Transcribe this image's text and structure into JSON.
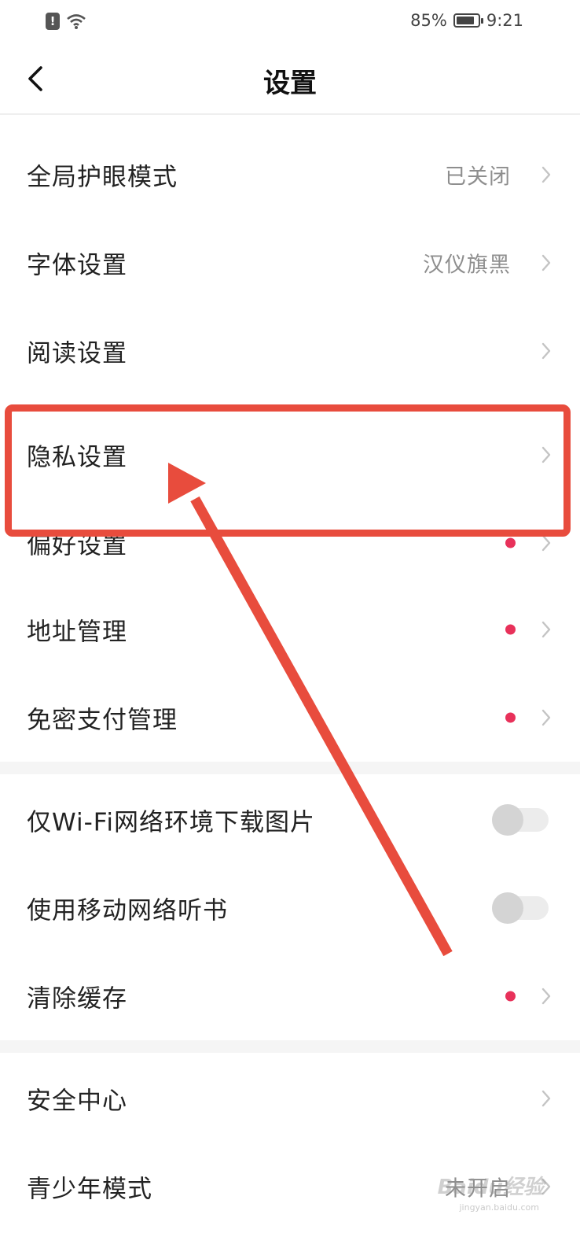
{
  "status_bar": {
    "battery_percent": "85%",
    "battery_level": 0.85,
    "time": "9:21"
  },
  "header": {
    "title": "设置"
  },
  "section1": [
    {
      "label": "全局护眼模式",
      "value": "已关闭"
    },
    {
      "label": "字体设置",
      "value": "汉仪旗黑"
    },
    {
      "label": "阅读设置"
    },
    {
      "label": "隐私设置"
    },
    {
      "label": "偏好设置",
      "badge": true
    },
    {
      "label": "地址管理",
      "badge": true
    },
    {
      "label": "免密支付管理",
      "badge": true
    }
  ],
  "section2": [
    {
      "label": "仅Wi-Fi网络环境下载图片",
      "toggle": false
    },
    {
      "label": "使用移动网络听书",
      "toggle": false
    },
    {
      "label": "清除缓存",
      "badge": true
    }
  ],
  "section3": [
    {
      "label": "安全中心"
    },
    {
      "label": "青少年模式",
      "value": "未开启"
    }
  ],
  "annotation": {
    "highlight_color": "#e84c3d"
  },
  "watermark": {
    "text": "Baidu经验",
    "sub": "jingyan.baidu.com"
  },
  "colors": {
    "badge": "#e8315a",
    "accent": "#e84c3d"
  }
}
